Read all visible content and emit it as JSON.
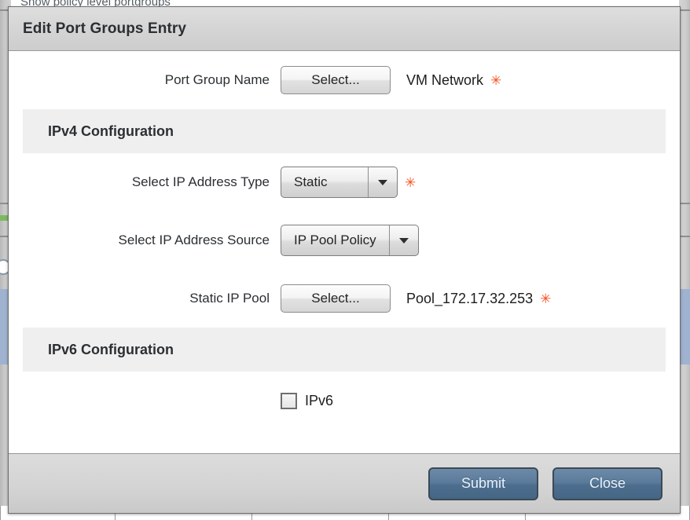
{
  "background": {
    "top_text": "Show policy level portgroups"
  },
  "dialog": {
    "title": "Edit Port Groups Entry",
    "rows": {
      "port_group_name": {
        "label": "Port Group Name",
        "button_label": "Select...",
        "value": "VM Network",
        "required_marker": "✳"
      },
      "ip_address_type": {
        "label": "Select IP Address Type",
        "value": "Static",
        "required_marker": "✳"
      },
      "ip_address_source": {
        "label": "Select IP Address Source",
        "value": "IP Pool Policy"
      },
      "static_ip_pool": {
        "label": "Static IP Pool",
        "button_label": "Select...",
        "value": "Pool_172.17.32.253",
        "required_marker": "✳"
      },
      "ipv6_checkbox": {
        "label": "IPv6",
        "checked": false
      }
    },
    "sections": {
      "ipv4": "IPv4 Configuration",
      "ipv6": "IPv6 Configuration"
    },
    "footer": {
      "submit_label": "Submit",
      "close_label": "Close"
    }
  },
  "colors": {
    "required_star": "#f4511e",
    "primary_button": "#54779a",
    "section_band": "#efefef",
    "titlebar": "#d6d6d6"
  }
}
